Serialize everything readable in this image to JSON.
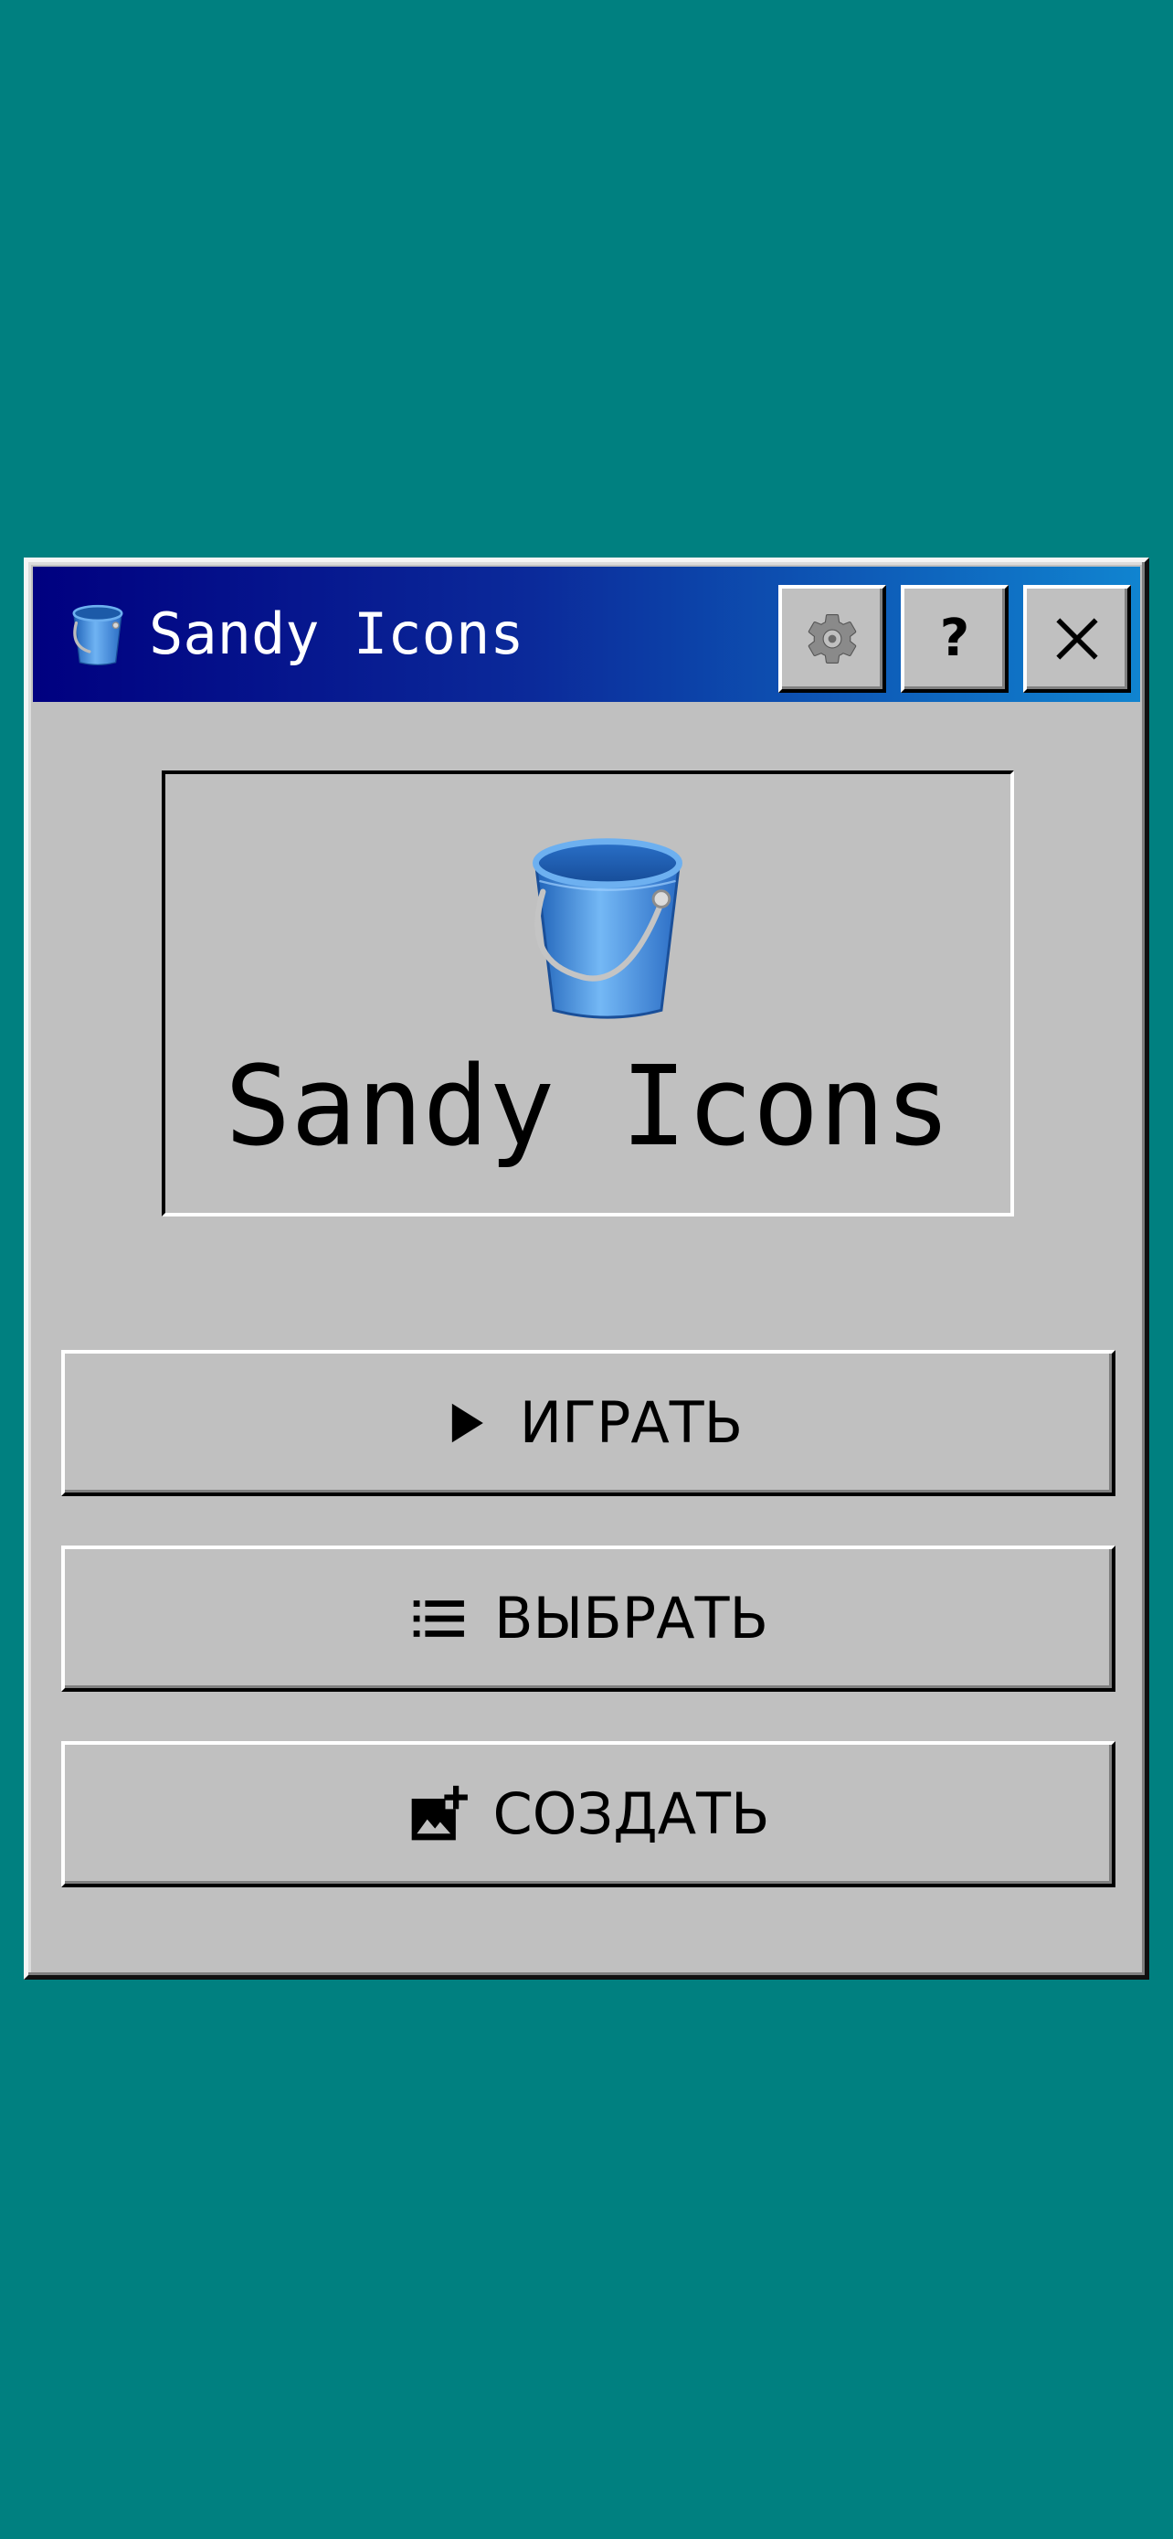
{
  "window": {
    "title": "Sandy Icons",
    "title_icon": "bucket-icon",
    "controls": {
      "settings_icon": "gear-icon",
      "help_label": "?",
      "close_icon": "close-icon"
    }
  },
  "logo": {
    "icon": "bucket-icon",
    "title": "Sandy Icons"
  },
  "menu": {
    "items": [
      {
        "id": "play",
        "label": "ИГРАТЬ",
        "icon": "play-icon"
      },
      {
        "id": "select",
        "label": "ВЫБРАТЬ",
        "icon": "list-icon"
      },
      {
        "id": "create",
        "label": "СОЗДАТЬ",
        "icon": "add-image-icon"
      }
    ]
  },
  "colors": {
    "desktop": "#008080",
    "window_face": "#c0c0c0",
    "titlebar_start": "#000080",
    "titlebar_end": "#1084d0",
    "bucket_blue": "#3a8fe0"
  }
}
